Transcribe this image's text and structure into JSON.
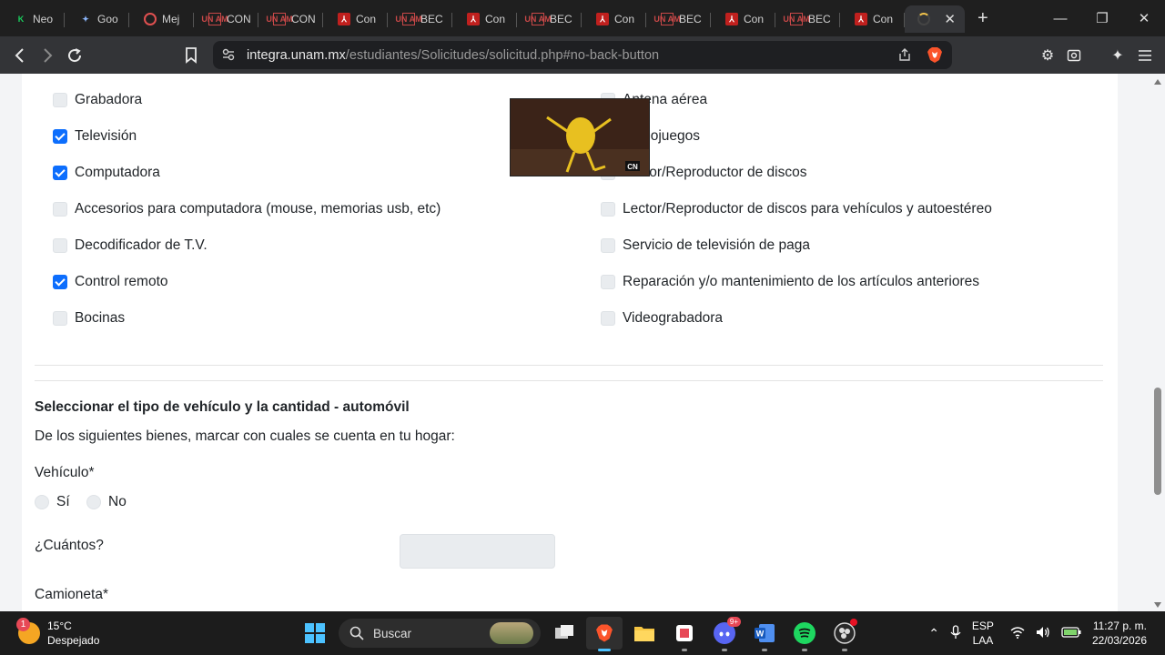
{
  "browser": {
    "tabs": [
      {
        "label": "Neo",
        "icon": "k-icon"
      },
      {
        "label": "Goo",
        "icon": "gemini-icon"
      },
      {
        "label": "Mej",
        "icon": "record-icon"
      },
      {
        "label": "CON",
        "icon": "unam-icon"
      },
      {
        "label": "CON",
        "icon": "unam-icon"
      },
      {
        "label": "Con",
        "icon": "pdf-icon"
      },
      {
        "label": "BEC",
        "icon": "unam-icon"
      },
      {
        "label": "Con",
        "icon": "pdf-icon"
      },
      {
        "label": "BEC",
        "icon": "unam-icon"
      },
      {
        "label": "Con",
        "icon": "pdf-icon"
      },
      {
        "label": "BEC",
        "icon": "unam-icon"
      },
      {
        "label": "Con",
        "icon": "pdf-icon"
      },
      {
        "label": "BEC",
        "icon": "unam-icon"
      },
      {
        "label": "Con",
        "icon": "pdf-icon"
      }
    ],
    "url_host": "integra.unam.mx",
    "url_path": "/estudiantes/Solicitudes/solicitud.php#no-back-button",
    "new_tab": "+",
    "close_tab": "✕"
  },
  "form": {
    "left_items": [
      {
        "label": "Grabadora",
        "checked": false
      },
      {
        "label": "Televisión",
        "checked": true
      },
      {
        "label": "Computadora",
        "checked": true
      },
      {
        "label": "Accesorios para computadora (mouse, memorias usb, etc)",
        "checked": false
      },
      {
        "label": "Decodificador de T.V.",
        "checked": false
      },
      {
        "label": "Control remoto",
        "checked": true
      },
      {
        "label": "Bocinas",
        "checked": false
      }
    ],
    "right_items": [
      {
        "label": "Antena aérea",
        "checked": false
      },
      {
        "label": "Videojuegos",
        "checked": false
      },
      {
        "label": "Lector/Reproductor de discos",
        "checked": false
      },
      {
        "label": "Lector/Reproductor de discos para vehículos y autoestéreo",
        "checked": false
      },
      {
        "label": "Servicio de televisión de paga",
        "checked": false
      },
      {
        "label": "Reparación y/o mantenimiento de los artículos anteriores",
        "checked": false
      },
      {
        "label": "Videograbadora",
        "checked": false
      }
    ],
    "section_title": "Seleccionar el tipo de vehículo y la cantidad - automóvil",
    "section_subtitle": "De los siguientes bienes, marcar con cuales se cuenta en tu hogar:",
    "vehicle_label": "Vehículo*",
    "radio_yes": "Sí",
    "radio_no": "No",
    "quantity_label": "¿Cuántos?",
    "quantity_value": "",
    "truck_label": "Camioneta*"
  },
  "video_overlay": {
    "badge": "CN"
  },
  "taskbar": {
    "weather_temp": "15°C",
    "weather_desc": "Despejado",
    "weather_badge": "1",
    "search_label": "Buscar",
    "discord_badge": "9+",
    "lang_1": "ESP",
    "lang_2": "LAA",
    "time": "11:27 p. m.",
    "date": "22/03/2026"
  }
}
